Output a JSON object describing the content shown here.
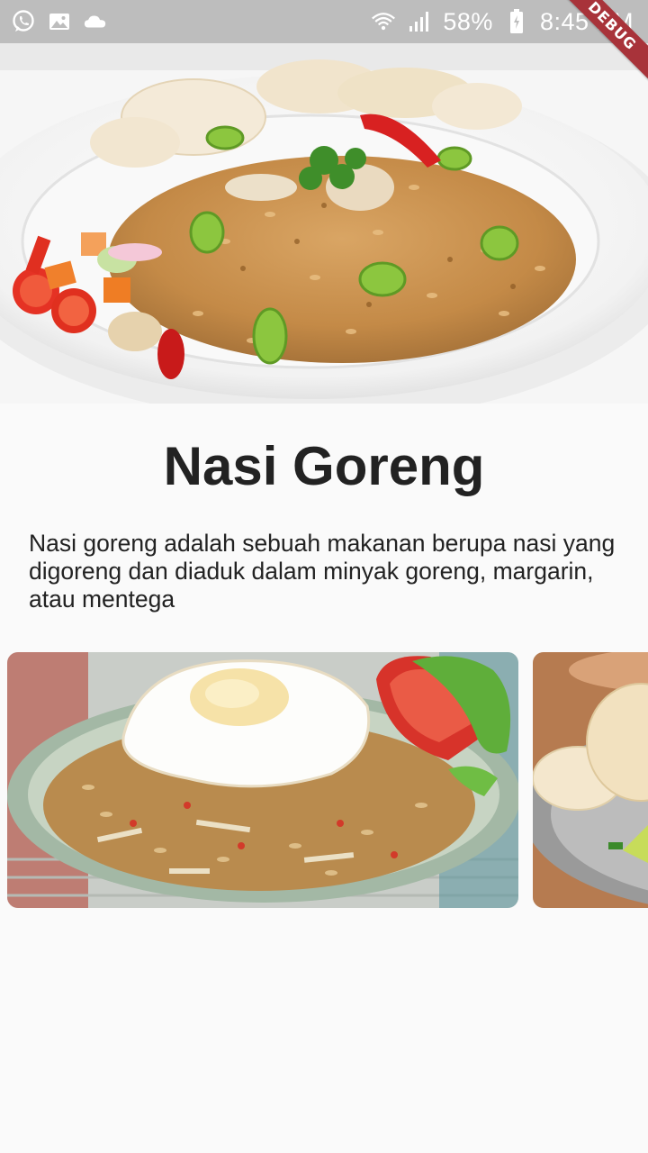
{
  "status_bar": {
    "left_icons": [
      "whatsapp-icon",
      "image-icon",
      "cloud-icon"
    ],
    "battery_percent": "58%",
    "time": "8:45 PM",
    "right_icons": [
      "wifi-icon",
      "signal-icon",
      "battery-icon"
    ]
  },
  "debug_banner": "DEBUG",
  "hero": {
    "image": "nasi-goreng-with-crackers-photo"
  },
  "content": {
    "title": "Nasi Goreng",
    "description": "Nasi goreng adalah sebuah makanan berupa nasi yang digoreng dan diaduk dalam minyak goreng, margarin, atau mentega"
  },
  "gallery": {
    "items": [
      {
        "image": "nasi-goreng-fried-egg-photo"
      },
      {
        "image": "nasi-goreng-crackers-photo"
      }
    ]
  },
  "colors": {
    "status_bar": "#bdbdbd",
    "background": "#fafafa",
    "text": "#222222",
    "debug_banner": "#a8333a"
  }
}
